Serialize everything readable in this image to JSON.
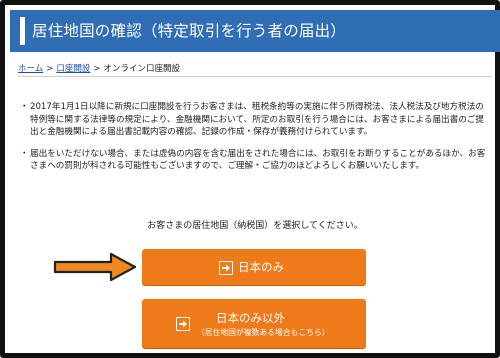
{
  "header": {
    "title": "居住地国の確認（特定取引を行う者の届出）"
  },
  "breadcrumb": {
    "home": "ホーム",
    "account": "口座開設",
    "current": "オンライン口座開設"
  },
  "notes": [
    {
      "bullet": "・",
      "text": "2017年1月1日以降に新規に口座開設を行うお客さまは、租税条約等の実施に伴う所得税法、法人税法及び地方税法の特例等に関する法律等の規定により、金融機関において、所定のお取引を行う場合には、お客さまによる届出書のご提出と金融機関による届出書記載内容の確認、記録の作成・保存が義務付けられています。"
    },
    {
      "bullet": "・",
      "text": "届出をいただけない場合、または虚偽の内容を含む届出をされた場合には、お取引をお断りすることがあるほか、お客さまへの罰則が科される可能性もございますので、ご理解・ご協力のほどよろしくお願いいたします。"
    }
  ],
  "prompt": "お客さまの居住地国（納税国）を選択してください。",
  "buttons": {
    "japan_only": {
      "label": "日本のみ"
    },
    "other": {
      "label": "日本のみ以外",
      "sub": "（居住地国が複数ある場合もこちら）"
    }
  },
  "colors": {
    "header_bg": "#2f6eb4",
    "button_bg": "#ef7a1a",
    "pointer": "#f0891f"
  },
  "icons": {
    "pointer": "orange-arrow-icon",
    "button": "arrow-right-icon"
  }
}
